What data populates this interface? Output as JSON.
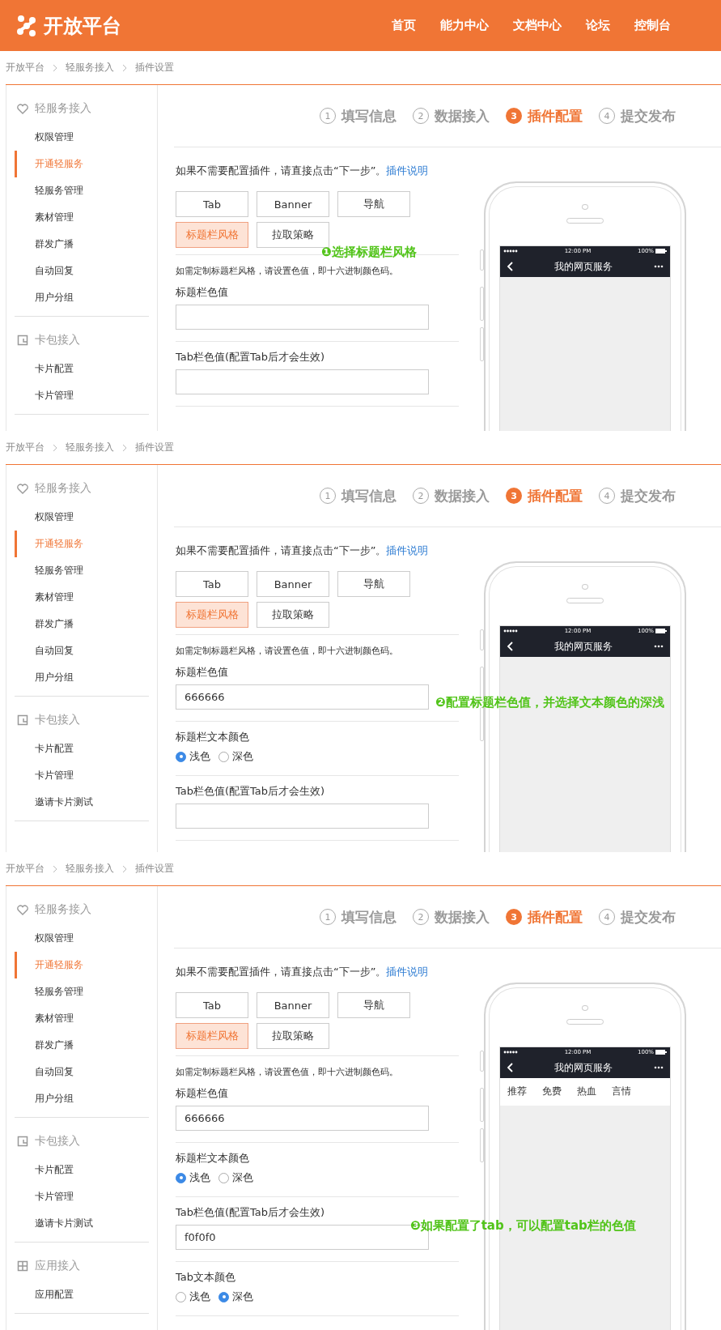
{
  "header": {
    "logo": "开放平台",
    "nav": [
      "首页",
      "能力中心",
      "文档中心",
      "论坛",
      "控制台"
    ]
  },
  "screens": [
    {
      "breadcrumb": [
        "开放平台",
        "轻服务接入",
        "插件设置"
      ],
      "sidebar": [
        {
          "title": "轻服务接入",
          "items": [
            {
              "label": "权限管理",
              "selected": false
            },
            {
              "label": "开通轻服务",
              "selected": true
            },
            {
              "label": "轻服务管理",
              "selected": false
            },
            {
              "label": "素材管理",
              "selected": false
            },
            {
              "label": "群发广播",
              "selected": false
            },
            {
              "label": "自动回复",
              "selected": false
            },
            {
              "label": "用户分组",
              "selected": false
            }
          ]
        },
        {
          "title": "卡包接入",
          "items": [
            {
              "label": "卡片配置",
              "selected": false
            },
            {
              "label": "卡片管理",
              "selected": false
            }
          ]
        }
      ],
      "steps": [
        {
          "number": "1",
          "label": "填写信息",
          "selected": false
        },
        {
          "number": "2",
          "label": "数据接入",
          "selected": false
        },
        {
          "number": "3",
          "label": "插件配置",
          "selected": true
        },
        {
          "number": "4",
          "label": "提交发布",
          "selected": false
        }
      ],
      "intro": "如果不需要配置插件，请直接点击“下一步”。",
      "intro_link": "插件说明",
      "plugins": [
        {
          "label": "Tab",
          "selected": false
        },
        {
          "label": "Banner",
          "selected": false
        },
        {
          "label": "导航",
          "selected": false
        },
        {
          "label": "标题栏风格",
          "selected": true
        },
        {
          "label": "拉取策略",
          "selected": false
        }
      ],
      "sections": [
        {
          "kind": "hint",
          "text": "如需定制标题栏风格，请设置色值，即十六进制颜色码。"
        },
        {
          "kind": "field",
          "label": "标题栏色值"
        },
        {
          "kind": "field",
          "label": "Tab栏色值(配置Tab后才会生效)"
        }
      ],
      "phone": {
        "time": "12:00 PM",
        "battery": "100%",
        "title": "我的网页服务"
      },
      "annotation": "❶选择标题栏风格"
    },
    {
      "breadcrumb": [
        "开放平台",
        "轻服务接入",
        "插件设置"
      ],
      "sidebar": [
        {
          "title": "轻服务接入",
          "items": [
            {
              "label": "权限管理",
              "selected": false
            },
            {
              "label": "开通轻服务",
              "selected": true
            },
            {
              "label": "轻服务管理",
              "selected": false
            },
            {
              "label": "素材管理",
              "selected": false
            },
            {
              "label": "群发广播",
              "selected": false
            },
            {
              "label": "自动回复",
              "selected": false
            },
            {
              "label": "用户分组",
              "selected": false
            }
          ]
        },
        {
          "title": "卡包接入",
          "items": [
            {
              "label": "卡片配置",
              "selected": false
            },
            {
              "label": "卡片管理",
              "selected": false
            },
            {
              "label": "邀请卡片测试",
              "selected": false
            }
          ]
        }
      ],
      "steps": [
        {
          "number": "1",
          "label": "填写信息",
          "selected": false
        },
        {
          "number": "2",
          "label": "数据接入",
          "selected": false
        },
        {
          "number": "3",
          "label": "插件配置",
          "selected": true
        },
        {
          "number": "4",
          "label": "提交发布",
          "selected": false
        }
      ],
      "intro": "如果不需要配置插件，请直接点击“下一步”。",
      "intro_link": "插件说明",
      "plugins": [
        {
          "label": "Tab",
          "selected": false
        },
        {
          "label": "Banner",
          "selected": false
        },
        {
          "label": "导航",
          "selected": false
        },
        {
          "label": "标题栏风格",
          "selected": true
        },
        {
          "label": "拉取策略",
          "selected": false
        }
      ],
      "sections": [
        {
          "kind": "hint",
          "text": "如需定制标题栏风格，请设置色值，即十六进制颜色码。"
        },
        {
          "kind": "field",
          "label": "标题栏色值",
          "value": "666666"
        },
        {
          "kind": "radio",
          "label": "标题栏文本颜色",
          "options": [
            {
              "label": "浅色",
              "selected": true
            },
            {
              "label": "深色",
              "selected": false
            }
          ]
        },
        {
          "kind": "field",
          "label": "Tab栏色值(配置Tab后才会生效)"
        }
      ],
      "phone": {
        "time": "12:00 PM",
        "battery": "100%",
        "title": "我的网页服务"
      },
      "annotation": "❷配置标题栏色值，并选择文本颜色的深浅"
    },
    {
      "breadcrumb": [
        "开放平台",
        "轻服务接入",
        "插件设置"
      ],
      "sidebar": [
        {
          "title": "轻服务接入",
          "items": [
            {
              "label": "权限管理",
              "selected": false
            },
            {
              "label": "开通轻服务",
              "selected": true
            },
            {
              "label": "轻服务管理",
              "selected": false
            },
            {
              "label": "素材管理",
              "selected": false
            },
            {
              "label": "群发广播",
              "selected": false
            },
            {
              "label": "自动回复",
              "selected": false
            },
            {
              "label": "用户分组",
              "selected": false
            }
          ]
        },
        {
          "title": "卡包接入",
          "items": [
            {
              "label": "卡片配置",
              "selected": false
            },
            {
              "label": "卡片管理",
              "selected": false
            },
            {
              "label": "邀请卡片测试",
              "selected": false
            }
          ]
        },
        {
          "title": "应用接入",
          "items": [
            {
              "label": "应用配置",
              "selected": false
            }
          ]
        }
      ],
      "steps": [
        {
          "number": "1",
          "label": "填写信息",
          "selected": false
        },
        {
          "number": "2",
          "label": "数据接入",
          "selected": false
        },
        {
          "number": "3",
          "label": "插件配置",
          "selected": true
        },
        {
          "number": "4",
          "label": "提交发布",
          "selected": false
        }
      ],
      "intro": "如果不需要配置插件，请直接点击“下一步”。",
      "intro_link": "插件说明",
      "plugins": [
        {
          "label": "Tab",
          "selected": false
        },
        {
          "label": "Banner",
          "selected": false
        },
        {
          "label": "导航",
          "selected": false
        },
        {
          "label": "标题栏风格",
          "selected": true
        },
        {
          "label": "拉取策略",
          "selected": false
        }
      ],
      "sections": [
        {
          "kind": "hint",
          "text": "如需定制标题栏风格，请设置色值，即十六进制颜色码。"
        },
        {
          "kind": "field",
          "label": "标题栏色值",
          "value": "666666"
        },
        {
          "kind": "radio",
          "label": "标题栏文本颜色",
          "options": [
            {
              "label": "浅色",
              "selected": true
            },
            {
              "label": "深色",
              "selected": false
            }
          ]
        },
        {
          "kind": "field",
          "label": "Tab栏色值(配置Tab后才会生效)",
          "value": "f0f0f0"
        },
        {
          "kind": "radio",
          "label": "Tab文本颜色",
          "options": [
            {
              "label": "浅色",
              "selected": false
            },
            {
              "label": "深色",
              "selected": true
            }
          ]
        }
      ],
      "phone": {
        "time": "12:00 PM",
        "battery": "100%",
        "title": "我的网页服务",
        "tabs": [
          "推荐",
          "免费",
          "热血",
          "言情"
        ]
      },
      "annotation": "❸如果配置了tab，可以配置tab栏的色值"
    }
  ]
}
